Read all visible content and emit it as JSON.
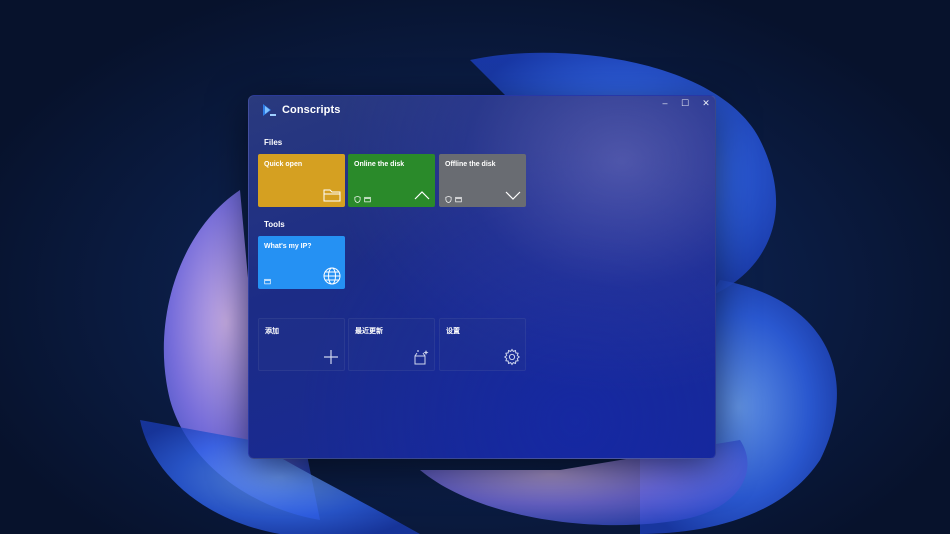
{
  "app": {
    "title": "Conscripts",
    "window_controls": {
      "minimize": "–",
      "maximize": "☐",
      "close": "✕"
    }
  },
  "sections": {
    "files": "Files",
    "tools": "Tools"
  },
  "tiles": {
    "quick_open": {
      "label": "Quick open",
      "color": "#d5a021",
      "icon": "folder-icon"
    },
    "online_disk": {
      "label": "Online the disk",
      "color": "#2a8a2a",
      "icon": "chevron-up-icon"
    },
    "offline_disk": {
      "label": "Offline the disk",
      "color": "#696c72",
      "icon": "chevron-down-icon"
    },
    "whats_my_ip": {
      "label": "What's my IP?",
      "color": "#2591f3",
      "icon": "globe-icon"
    },
    "add": {
      "label": "添加",
      "icon": "plus-icon"
    },
    "recent_updates": {
      "label": "最近更新",
      "icon": "sparkle-box-icon"
    },
    "settings": {
      "label": "设置",
      "icon": "gear-icon"
    }
  }
}
